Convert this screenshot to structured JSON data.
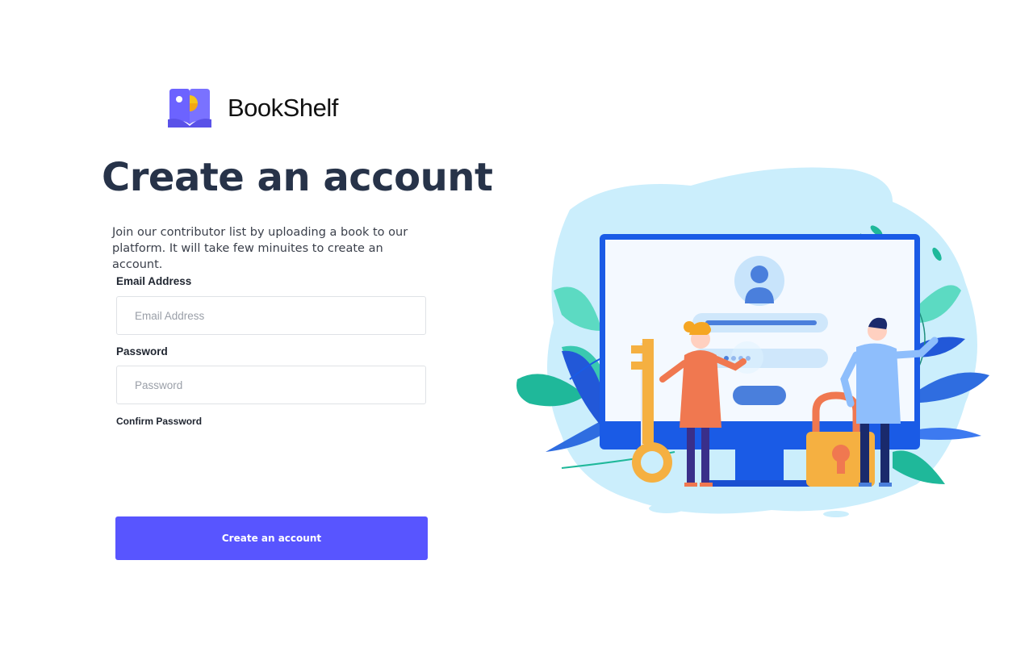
{
  "brand": {
    "name_bold": "Book",
    "name_light": "Shelf",
    "icon": "book-logo-icon",
    "colors": {
      "book": "#6c63ff",
      "accent": "#f5c518"
    }
  },
  "header": {
    "title": "Create an account",
    "subtitle": "Join our contributor list by uploading a book to our platform. It will take few minuites to create an account."
  },
  "form": {
    "email_label": "Email Address",
    "email_placeholder": "Email Address",
    "email_value": "",
    "password_label": "Password",
    "password_placeholder": "Password",
    "password_value": "",
    "confirm_label": "Confirm Password",
    "submit_label": "Create an account"
  },
  "illustration": {
    "icon": "signup-illustration",
    "colors": {
      "primary": "#1a5be6",
      "blob": "#c8ebfb",
      "key": "#f5b041",
      "lock": "#f5a623"
    }
  },
  "colors": {
    "button": "#5855ff",
    "title": "#273349"
  }
}
